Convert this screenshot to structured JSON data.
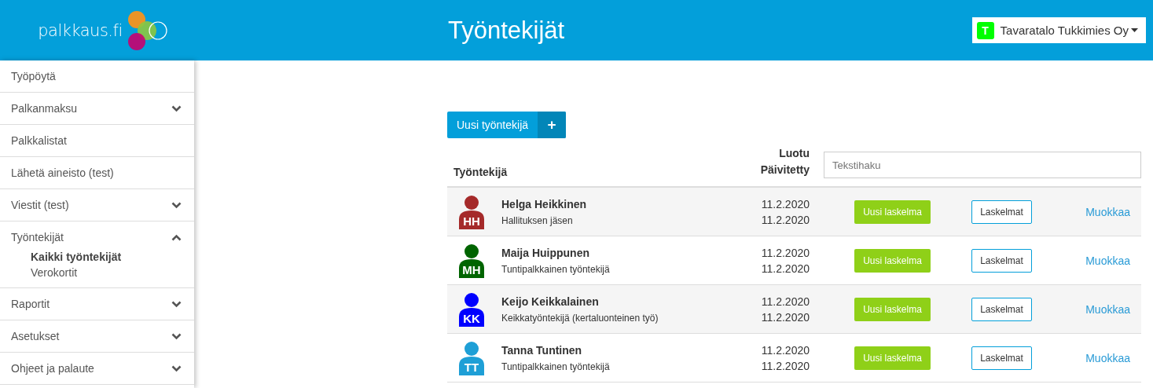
{
  "logo": {
    "text": "palkkaus.fi"
  },
  "header": {
    "title": "Työntekijät",
    "company": {
      "initial": "T",
      "name": "Tavaratalo Tukkimies Oy",
      "color": "#00ff00"
    }
  },
  "sidebar": {
    "items": [
      {
        "label": "Työpöytä"
      },
      {
        "label": "Palkanmaksu",
        "expanded": false
      },
      {
        "label": "Palkkalistat"
      },
      {
        "label": "Lähetä aineisto (test)"
      },
      {
        "label": "Viestit (test)",
        "expanded": false
      },
      {
        "label": "Työntekijät",
        "expanded": true,
        "children": [
          {
            "label": "Kaikki työntekijät",
            "selected": true
          },
          {
            "label": "Verokortit",
            "selected": false
          }
        ]
      },
      {
        "label": "Raportit",
        "expanded": false
      },
      {
        "label": "Asetukset",
        "expanded": false
      },
      {
        "label": "Ohjeet ja palaute",
        "expanded": false
      }
    ]
  },
  "new_employee_button": {
    "label": "Uusi työntekijä",
    "icon": "+"
  },
  "table": {
    "columns": [
      "Työntekijä",
      "Luotu",
      "Päivitetty"
    ],
    "search": {
      "placeholder": "Tekstihaku"
    },
    "rows": [
      {
        "initials": "HH",
        "color": "#a52a2a",
        "name": "Helga Heikkinen",
        "role": "Hallituksen jäsen",
        "created": "11.2.2020",
        "updated": "11.2.2020",
        "new_calc": "Uusi laskelma",
        "calcs": "Laskelmat",
        "edit": "Muokkaa"
      },
      {
        "initials": "MH",
        "color": "#006400",
        "name": "Maija Huippunen",
        "role": "Tuntipalkkainen työntekijä",
        "created": "11.2.2020",
        "updated": "11.2.2020",
        "new_calc": "Uusi laskelma",
        "calcs": "Laskelmat",
        "edit": "Muokkaa"
      },
      {
        "initials": "KK",
        "color": "#0000ff",
        "name": "Keijo Keikkalainen",
        "role": "Keikkatyöntekijä (kertaluonteinen työ)",
        "created": "11.2.2020",
        "updated": "11.2.2020",
        "new_calc": "Uusi laskelma",
        "calcs": "Laskelmat",
        "edit": "Muokkaa"
      },
      {
        "initials": "TT",
        "color": "#1e9fd6",
        "name": "Tanna Tuntinen",
        "role": "Tuntipalkkainen työntekijä",
        "created": "11.2.2020",
        "updated": "11.2.2020",
        "new_calc": "Uusi laskelma",
        "calcs": "Laskelmat",
        "edit": "Muokkaa"
      }
    ]
  }
}
